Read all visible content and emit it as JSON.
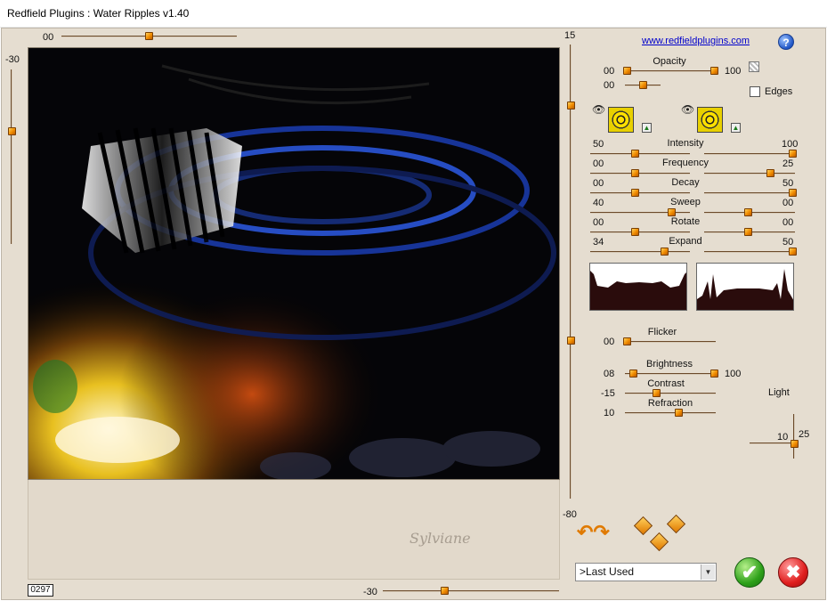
{
  "window": {
    "title": "Redfield Plugins : Water Ripples v1.40"
  },
  "preview": {
    "top_slider_value": "00",
    "left_slider_value": "-30",
    "bottom_slider_value": "-30",
    "right_slider_top": "15",
    "right_slider_bottom": "-80",
    "counter": "0297",
    "watermark": "Sylviane"
  },
  "header": {
    "link": "www.redfieldplugins.com",
    "help": "?"
  },
  "opacity": {
    "label": "Opacity",
    "min": "00",
    "max": "100",
    "value2": "00"
  },
  "edges": {
    "label": "Edges"
  },
  "params": [
    {
      "left": "50",
      "label": "Intensity",
      "right": "100"
    },
    {
      "left": "00",
      "label": "Frequency",
      "right": "25"
    },
    {
      "left": "00",
      "label": "Decay",
      "right": "50"
    },
    {
      "left": "40",
      "label": "Sweep",
      "right": "00"
    },
    {
      "left": "00",
      "label": "Rotate",
      "right": "00"
    },
    {
      "left": "34",
      "label": "Expand",
      "right": "50"
    }
  ],
  "lighting": {
    "flicker_label": "Flicker",
    "flicker_value": "00",
    "brightness_label": "Brightness",
    "brightness_value": "08",
    "brightness_max": "100",
    "contrast_label": "Contrast",
    "contrast_value": "-15",
    "refraction_label": "Refraction",
    "refraction_value": "10",
    "light_label": "Light",
    "light_h": "10",
    "light_v": "25"
  },
  "preset": {
    "selected": ">Last Used"
  },
  "buttons": {
    "ok": "✔",
    "cancel": "✖"
  },
  "icons": {
    "eye": "👁",
    "tri": "▲",
    "rotate": "↶↷"
  },
  "colors": {
    "background": "#e5ddd0",
    "thumb": "#f08a00",
    "track": "#6b4a2a"
  }
}
